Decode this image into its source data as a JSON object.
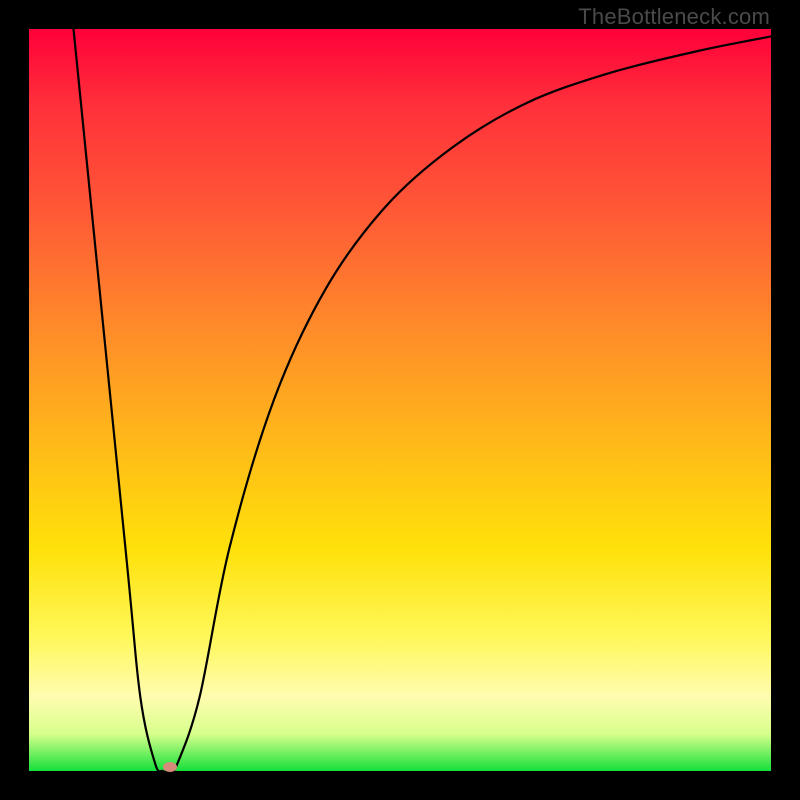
{
  "watermark": "TheBottleneck.com",
  "chart_data": {
    "type": "line",
    "title": "",
    "xlabel": "",
    "ylabel": "",
    "xlim": [
      0,
      100
    ],
    "ylim": [
      0,
      100
    ],
    "grid": false,
    "series": [
      {
        "name": "curve",
        "x": [
          6,
          13,
          15,
          17,
          18,
          19,
          20,
          23,
          27,
          33,
          40,
          48,
          57,
          67,
          78,
          90,
          100
        ],
        "values": [
          100,
          30,
          10,
          1,
          0,
          0,
          1,
          10,
          30,
          50,
          65,
          76,
          84,
          90,
          94,
          97,
          99
        ]
      }
    ],
    "marker": {
      "x": 19,
      "y": 0.5,
      "color": "#d58a7a"
    },
    "background_gradient": {
      "top": "#ff003a",
      "mid1": "#ff8a2a",
      "mid2": "#ffe10a",
      "bottom": "#15e03a"
    }
  }
}
